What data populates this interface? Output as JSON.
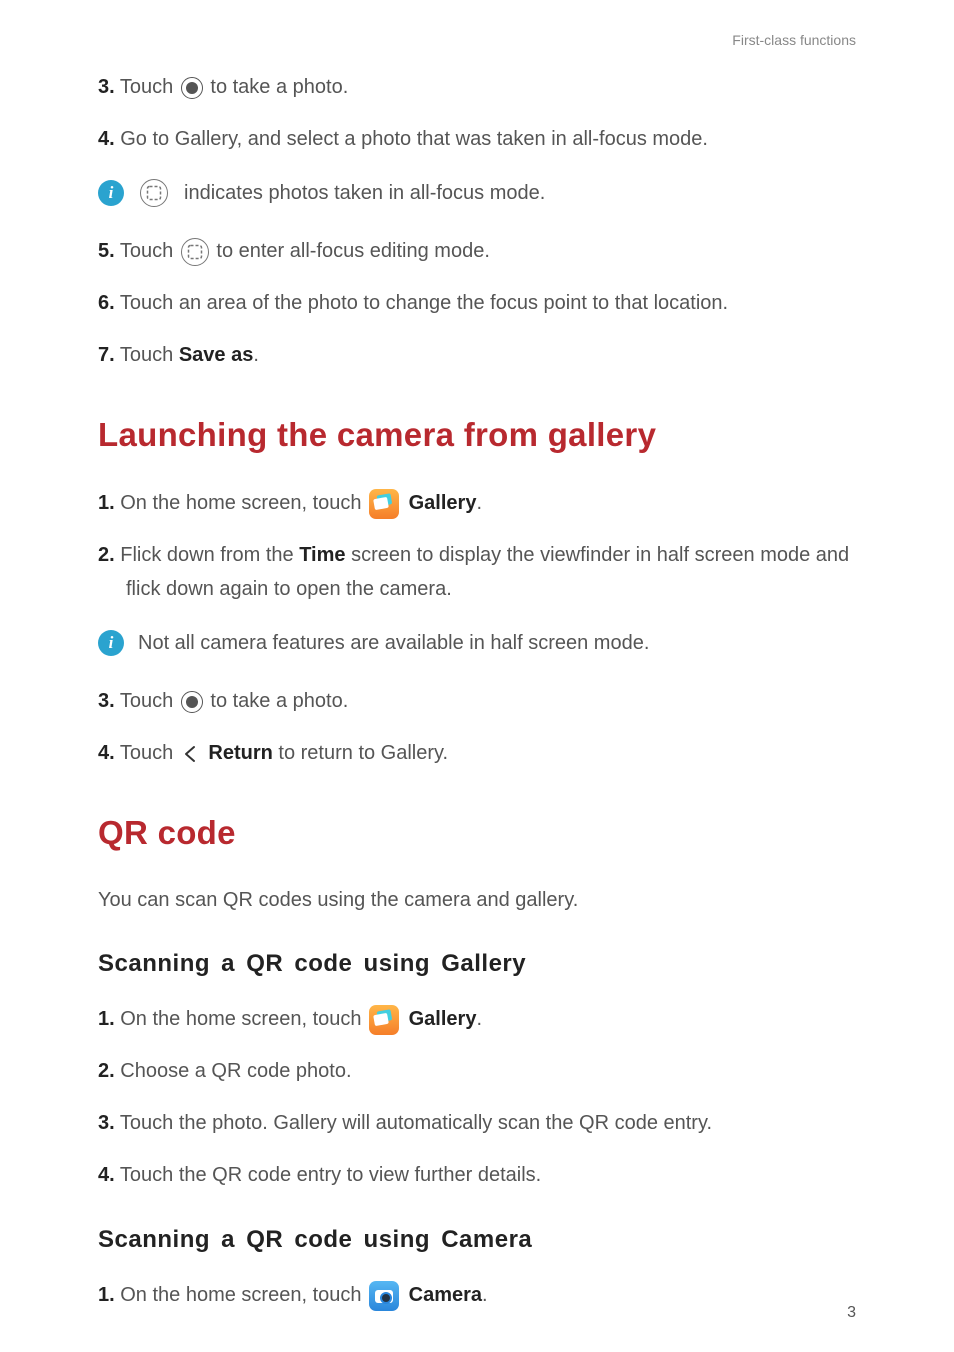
{
  "header": {
    "section_label": "First-class functions"
  },
  "page_number": "3",
  "steps_a": {
    "s3": {
      "num": "3.",
      "pre": "Touch ",
      "post": " to take a photo."
    },
    "s4": {
      "num": "4.",
      "text": "Go to Gallery, and select a photo that was taken in all-focus mode."
    },
    "note": {
      "text": " indicates photos taken in all-focus mode."
    },
    "s5": {
      "num": "5.",
      "pre": "Touch ",
      "post": " to enter all-focus editing mode."
    },
    "s6": {
      "num": "6.",
      "text": "Touch an area of the photo to change the focus point to that location."
    },
    "s7": {
      "num": "7.",
      "pre": "Touch ",
      "bold": "Save as",
      "post": "."
    }
  },
  "launch_heading": "Launching the camera from gallery",
  "launch": {
    "s1": {
      "num": "1.",
      "pre": "On the home screen, touch ",
      "bold": "Gallery",
      "post": "."
    },
    "s2": {
      "num": "2.",
      "pre": "Flick down from the ",
      "bold": "Time",
      "post": " screen to display the viewfinder in half screen mode and flick down again to open the camera."
    },
    "note": {
      "text": "Not all camera features are available in half screen mode."
    },
    "s3": {
      "num": "3.",
      "pre": "Touch ",
      "post": " to take a photo."
    },
    "s4": {
      "num": "4.",
      "pre": "Touch ",
      "bold": "Return",
      "post": " to return to Gallery."
    }
  },
  "qr_heading": "QR code",
  "qr_intro": "You can scan QR codes using the camera and gallery.",
  "qr_gallery_heading": "Scanning a QR code using Gallery",
  "qr_gallery": {
    "s1": {
      "num": "1.",
      "pre": "On the home screen, touch ",
      "bold": "Gallery",
      "post": "."
    },
    "s2": {
      "num": "2.",
      "text": "Choose a QR code photo."
    },
    "s3": {
      "num": "3.",
      "text": "Touch the photo. Gallery will automatically scan the QR code entry."
    },
    "s4": {
      "num": "4.",
      "text": "Touch the QR code entry to view further details."
    }
  },
  "qr_camera_heading": "Scanning a QR code using Camera",
  "qr_camera": {
    "s1": {
      "num": "1.",
      "pre": "On the home screen, touch ",
      "bold": "Camera",
      "post": "."
    }
  }
}
